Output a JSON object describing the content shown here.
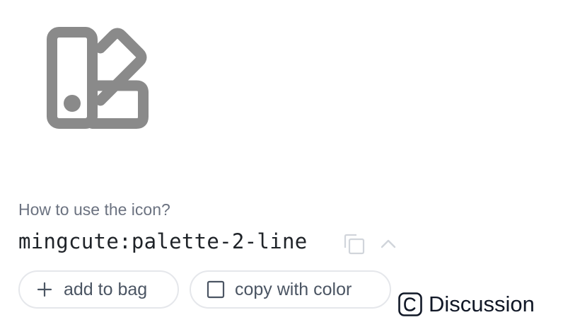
{
  "preview": {
    "icon": "palette-2-line-icon",
    "icon_color": "#8a8a8a"
  },
  "usage": {
    "heading": "How to use the icon?",
    "icon_name": "mingcute:palette-2-line",
    "copy_icon": "copy-icon",
    "toggle_icon": "chevron-up-icon"
  },
  "actions": {
    "add_to_bag_label": "add to bag",
    "add_icon": "plus-icon",
    "copy_with_color_label": "copy with color",
    "checkbox_icon": "checkbox-icon"
  },
  "discussion": {
    "label": "Discussion",
    "icon": "c-square-icon"
  },
  "colors": {
    "muted_text": "#6b7280",
    "border": "#e5e7eb",
    "text": "#1f2328"
  }
}
